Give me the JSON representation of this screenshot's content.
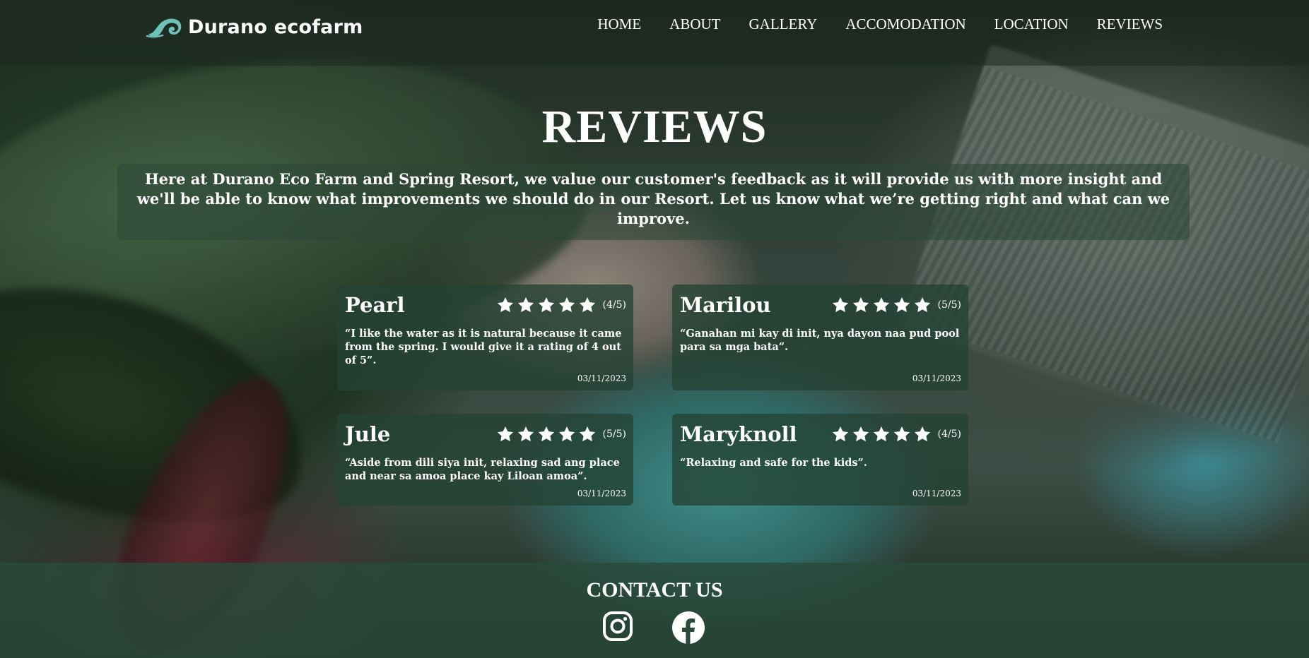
{
  "brand": {
    "name": "Durano ecofarm",
    "logo_icon": "wave-icon"
  },
  "nav": {
    "links": [
      "HOME",
      "ABOUT",
      "GALLERY",
      "ACCOMODATION",
      "LOCATION",
      "REVIEWS"
    ]
  },
  "page": {
    "title": "REVIEWS",
    "intro": "Here at Durano Eco Farm and Spring Resort, we value our customer's feedback as it will provide us with more insight and we'll be able to know what improvements we should do in our Resort. Let us know what we’re getting right and what can we improve."
  },
  "reviews": [
    {
      "name": "Pearl",
      "stars": 5,
      "score": "(4/5)",
      "text": "“I like the water as it is natural because it came from the spring. I would give it a rating of 4 out of 5”.",
      "date": "03/11/2023"
    },
    {
      "name": "Marilou",
      "stars": 5,
      "score": "(5/5)",
      "text": "“Ganahan mi kay di init, nya dayon naa pud pool para sa mga bata”.",
      "date": "03/11/2023"
    },
    {
      "name": "Jule",
      "stars": 5,
      "score": "(5/5)",
      "text": "“Aside from dili siya init, relaxing sad ang place and near sa amoa place kay Liloan amoa”.",
      "date": "03/11/2023"
    },
    {
      "name": "Maryknoll",
      "stars": 5,
      "score": "(4/5)",
      "text": "“Relaxing and safe for the kids”.",
      "date": "03/11/2023"
    }
  ],
  "contact": {
    "title": "CONTACT US",
    "icons": [
      "instagram-icon",
      "facebook-icon"
    ]
  },
  "colors": {
    "panel": "#2c4a3a",
    "logo_accent": "#6fc2b8"
  }
}
